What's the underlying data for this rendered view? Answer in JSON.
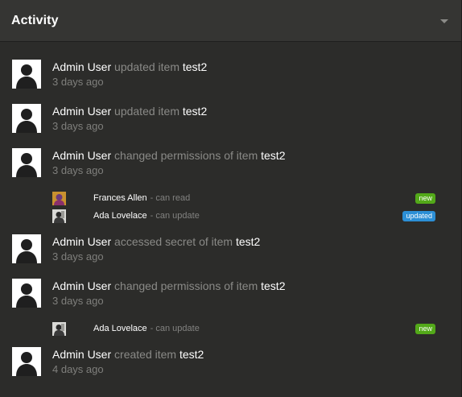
{
  "header": {
    "title": "Activity"
  },
  "entries": [
    {
      "actor": "Admin User",
      "verb": "updated item",
      "target": "test2",
      "time": "3 days ago"
    },
    {
      "actor": "Admin User",
      "verb": "updated item",
      "target": "test2",
      "time": "3 days ago"
    },
    {
      "actor": "Admin User",
      "verb": "changed permissions of item",
      "target": "test2",
      "time": "3 days ago",
      "details": [
        {
          "name": "Frances Allen",
          "perm": "- can read",
          "badge": "new"
        },
        {
          "name": "Ada Lovelace",
          "perm": "- can update",
          "badge": "updated"
        }
      ]
    },
    {
      "actor": "Admin User",
      "verb": "accessed secret of item",
      "target": "test2",
      "time": "3 days ago"
    },
    {
      "actor": "Admin User",
      "verb": "changed permissions of item",
      "target": "test2",
      "time": "3 days ago",
      "details": [
        {
          "name": "Ada Lovelace",
          "perm": "- can update",
          "badge": "new"
        }
      ]
    },
    {
      "actor": "Admin User",
      "verb": "created item",
      "target": "test2",
      "time": "4 days ago"
    }
  ],
  "colors": {
    "new_badge": "#53a919",
    "updated_badge": "#2c8fd6",
    "background": "#2c2c2a",
    "muted": "#8a8a87"
  },
  "icons": {
    "user_avatar": "default-user-silhouette-icon",
    "collapse": "chevron-down-icon"
  }
}
